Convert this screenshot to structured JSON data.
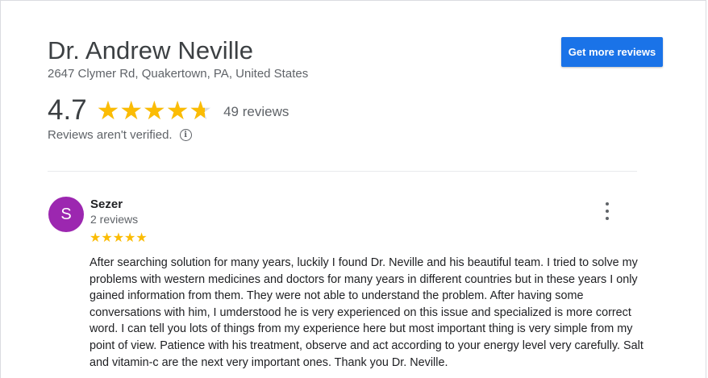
{
  "business": {
    "name": "Dr. Andrew Neville",
    "address": "2647 Clymer Rd, Quakertown, PA, United States",
    "get_reviews_label": "Get more reviews"
  },
  "rating": {
    "value": "4.7",
    "fraction": 0.94,
    "stars": "★★★★★",
    "count_label": "49 reviews",
    "verification_note": "Reviews aren't verified.",
    "info_icon": "info-icon"
  },
  "review": {
    "avatar_letter": "S",
    "avatar_color": "#9c27b0",
    "name": "Sezer",
    "reviewer_review_count": "2 reviews",
    "rating": 5,
    "stars": "★★★★★",
    "text": "After searching solution for many years, luckily I found Dr. Neville and his beautiful team. I tried to solve my problems with western medicines and doctors for many years in different countries but in these years I only gained information from them. They were not able to understand the problem. After having some conversations with him, I umderstood he is very experienced on this issue and specialized is more correct word. I can tell you lots of things from my experience here but most important thing is very simple from my point of view. Patience with his treatment, observe and act according to your energy level very carefully. Salt and vitamin-c are the next very important ones. Thank you Dr. Neville.",
    "menu_icon": "more-vert-icon"
  },
  "colors": {
    "accent": "#1a73e8",
    "star": "#fbbc04",
    "star_empty": "#dadce0"
  }
}
